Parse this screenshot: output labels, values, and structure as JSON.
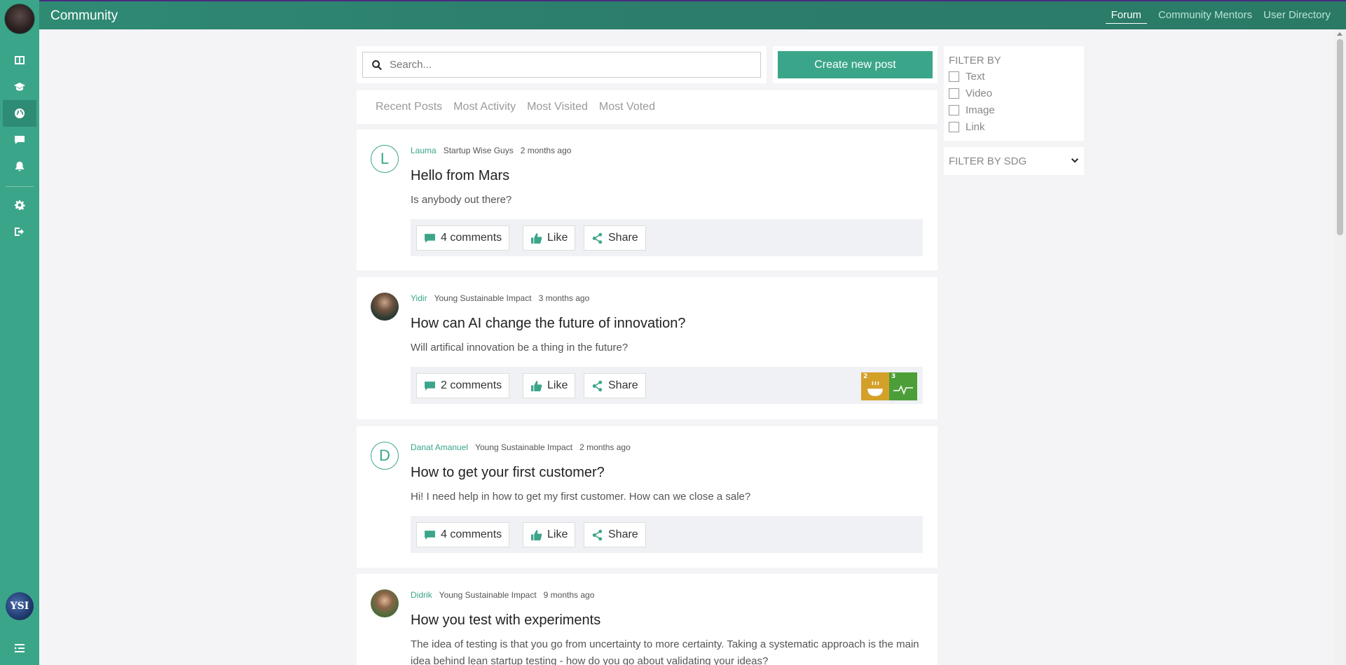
{
  "app": {
    "title": "Community"
  },
  "header": {
    "tabs": [
      {
        "label": "Forum",
        "active": true
      },
      {
        "label": "Community Mentors",
        "active": false
      },
      {
        "label": "User Directory",
        "active": false
      }
    ]
  },
  "sidebar": {
    "items": [
      {
        "icon": "dashboard-icon"
      },
      {
        "icon": "graduation-cap-icon"
      },
      {
        "icon": "globe-icon",
        "active": true
      },
      {
        "icon": "chat-icon"
      },
      {
        "icon": "bell-icon"
      },
      {
        "icon": "gear-icon"
      },
      {
        "icon": "logout-icon"
      }
    ],
    "org_logo_text": "YSI",
    "collapse_icon": "menu-collapse-icon"
  },
  "search": {
    "placeholder": "Search..."
  },
  "create_button": {
    "label": "Create new post"
  },
  "sort_tabs": [
    "Recent Posts",
    "Most Activity",
    "Most Visited",
    "Most Voted"
  ],
  "posts": [
    {
      "avatar_letter": "L",
      "author": "Lauma",
      "org": "Startup Wise Guys",
      "time": "2 months ago",
      "title": "Hello from Mars",
      "body": "Is anybody out there?",
      "comments": "4 comments",
      "like": "Like",
      "share": "Share"
    },
    {
      "avatar_letter": "",
      "author": "Yidir",
      "org": "Young Sustainable Impact",
      "time": "3 months ago",
      "title": "How can AI change the future of innovation?",
      "body": "Will artifical innovation be a thing in the future?",
      "comments": "2 comments",
      "like": "Like",
      "share": "Share",
      "sdgs": [
        {
          "number": "2",
          "color": "#d3a029"
        },
        {
          "number": "3",
          "color": "#4c9f38"
        }
      ]
    },
    {
      "avatar_letter": "D",
      "author": "Danat Amanuel",
      "org": "Young Sustainable Impact",
      "time": "2 months ago",
      "title": "How to get your first customer?",
      "body": "Hi! I need help in how to get my first customer. How can we close a sale?",
      "comments": "4 comments",
      "like": "Like",
      "share": "Share"
    },
    {
      "avatar_letter": "",
      "author": "Didrik",
      "org": "Young Sustainable Impact",
      "time": "9 months ago",
      "title": "How you test with experiments",
      "body": "The idea of testing is that you go from uncertainty to more certainty. Taking a systematic approach is the main idea behind lean startup testing - how do you go about validating your ideas?"
    }
  ],
  "filter": {
    "title": "FILTER BY",
    "options": [
      "Text",
      "Video",
      "Image",
      "Link"
    ],
    "sdg_label": "FILTER BY SDG"
  },
  "colors": {
    "brand": "#3ba58a",
    "header": "#2c7f6b"
  }
}
